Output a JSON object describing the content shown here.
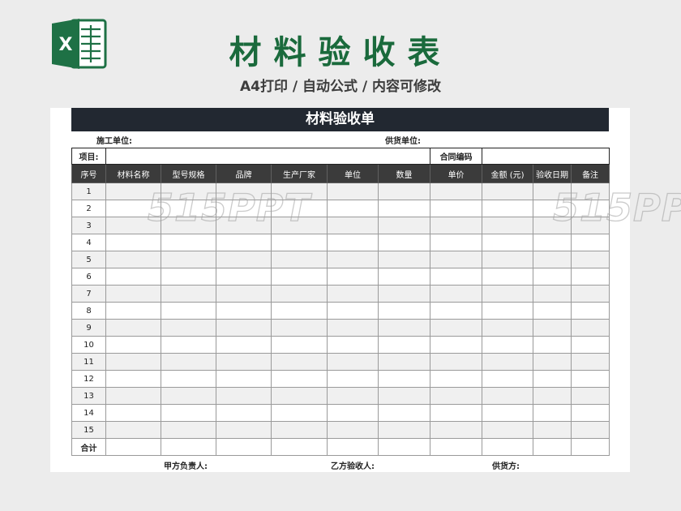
{
  "header": {
    "title": "材料验收表",
    "subtitle": "A4打印 / 自动公式 / 内容可修改",
    "logo_letter": "X"
  },
  "form": {
    "title": "材料验收单",
    "construction_unit_label": "施工单位:",
    "supplier_unit_label": "供货单位:",
    "project_label": "项目:",
    "contract_no_label": "合同编码",
    "columns": [
      "序号",
      "材料名称",
      "型号规格",
      "品牌",
      "生产厂家",
      "单位",
      "数量",
      "单价",
      "金额 (元)",
      "验收日期",
      "备注"
    ],
    "row_numbers": [
      "1",
      "2",
      "3",
      "4",
      "5",
      "6",
      "7",
      "8",
      "9",
      "10",
      "11",
      "12",
      "13",
      "14",
      "15"
    ],
    "total_label": "合计",
    "signatures": {
      "party_a": "甲方负责人:",
      "party_b": "乙方验收人:",
      "supplier": "供货方:"
    }
  },
  "watermark": "515PPT",
  "colors": {
    "title_green": "#1a6a3c",
    "form_header_dark": "#222831",
    "column_header": "#3b3b3b",
    "excel_green": "#1e7145"
  }
}
